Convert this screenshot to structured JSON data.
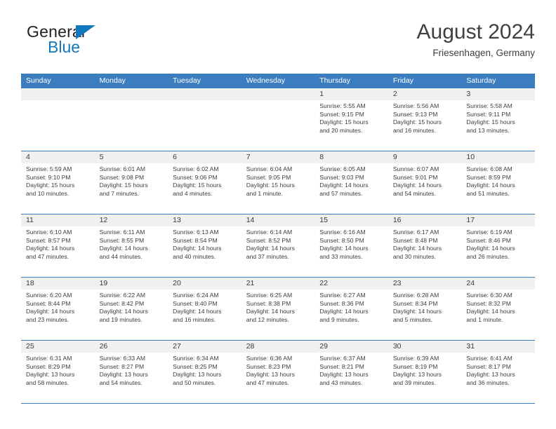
{
  "brand": {
    "name_part1": "General",
    "name_part2": "Blue",
    "triangle_color": "#1277bc",
    "text_color": "#231f20"
  },
  "header": {
    "title": "August 2024",
    "subtitle": "Friesenhagen, Germany"
  },
  "theme": {
    "header_band": "#3b7dbf",
    "date_strip": "#f0f0f0",
    "row_divider": "#3b7dbf",
    "text": "#3a3a3a"
  },
  "weekdays": [
    "Sunday",
    "Monday",
    "Tuesday",
    "Wednesday",
    "Thursday",
    "Friday",
    "Saturday"
  ],
  "weeks": [
    [
      {
        "day": "",
        "lines": []
      },
      {
        "day": "",
        "lines": []
      },
      {
        "day": "",
        "lines": []
      },
      {
        "day": "",
        "lines": []
      },
      {
        "day": "1",
        "lines": [
          "Sunrise: 5:55 AM",
          "Sunset: 9:15 PM",
          "Daylight: 15 hours",
          "and 20 minutes."
        ]
      },
      {
        "day": "2",
        "lines": [
          "Sunrise: 5:56 AM",
          "Sunset: 9:13 PM",
          "Daylight: 15 hours",
          "and 16 minutes."
        ]
      },
      {
        "day": "3",
        "lines": [
          "Sunrise: 5:58 AM",
          "Sunset: 9:11 PM",
          "Daylight: 15 hours",
          "and 13 minutes."
        ]
      }
    ],
    [
      {
        "day": "4",
        "lines": [
          "Sunrise: 5:59 AM",
          "Sunset: 9:10 PM",
          "Daylight: 15 hours",
          "and 10 minutes."
        ]
      },
      {
        "day": "5",
        "lines": [
          "Sunrise: 6:01 AM",
          "Sunset: 9:08 PM",
          "Daylight: 15 hours",
          "and 7 minutes."
        ]
      },
      {
        "day": "6",
        "lines": [
          "Sunrise: 6:02 AM",
          "Sunset: 9:06 PM",
          "Daylight: 15 hours",
          "and 4 minutes."
        ]
      },
      {
        "day": "7",
        "lines": [
          "Sunrise: 6:04 AM",
          "Sunset: 9:05 PM",
          "Daylight: 15 hours",
          "and 1 minute."
        ]
      },
      {
        "day": "8",
        "lines": [
          "Sunrise: 6:05 AM",
          "Sunset: 9:03 PM",
          "Daylight: 14 hours",
          "and 57 minutes."
        ]
      },
      {
        "day": "9",
        "lines": [
          "Sunrise: 6:07 AM",
          "Sunset: 9:01 PM",
          "Daylight: 14 hours",
          "and 54 minutes."
        ]
      },
      {
        "day": "10",
        "lines": [
          "Sunrise: 6:08 AM",
          "Sunset: 8:59 PM",
          "Daylight: 14 hours",
          "and 51 minutes."
        ]
      }
    ],
    [
      {
        "day": "11",
        "lines": [
          "Sunrise: 6:10 AM",
          "Sunset: 8:57 PM",
          "Daylight: 14 hours",
          "and 47 minutes."
        ]
      },
      {
        "day": "12",
        "lines": [
          "Sunrise: 6:11 AM",
          "Sunset: 8:55 PM",
          "Daylight: 14 hours",
          "and 44 minutes."
        ]
      },
      {
        "day": "13",
        "lines": [
          "Sunrise: 6:13 AM",
          "Sunset: 8:54 PM",
          "Daylight: 14 hours",
          "and 40 minutes."
        ]
      },
      {
        "day": "14",
        "lines": [
          "Sunrise: 6:14 AM",
          "Sunset: 8:52 PM",
          "Daylight: 14 hours",
          "and 37 minutes."
        ]
      },
      {
        "day": "15",
        "lines": [
          "Sunrise: 6:16 AM",
          "Sunset: 8:50 PM",
          "Daylight: 14 hours",
          "and 33 minutes."
        ]
      },
      {
        "day": "16",
        "lines": [
          "Sunrise: 6:17 AM",
          "Sunset: 8:48 PM",
          "Daylight: 14 hours",
          "and 30 minutes."
        ]
      },
      {
        "day": "17",
        "lines": [
          "Sunrise: 6:19 AM",
          "Sunset: 8:46 PM",
          "Daylight: 14 hours",
          "and 26 minutes."
        ]
      }
    ],
    [
      {
        "day": "18",
        "lines": [
          "Sunrise: 6:20 AM",
          "Sunset: 8:44 PM",
          "Daylight: 14 hours",
          "and 23 minutes."
        ]
      },
      {
        "day": "19",
        "lines": [
          "Sunrise: 6:22 AM",
          "Sunset: 8:42 PM",
          "Daylight: 14 hours",
          "and 19 minutes."
        ]
      },
      {
        "day": "20",
        "lines": [
          "Sunrise: 6:24 AM",
          "Sunset: 8:40 PM",
          "Daylight: 14 hours",
          "and 16 minutes."
        ]
      },
      {
        "day": "21",
        "lines": [
          "Sunrise: 6:25 AM",
          "Sunset: 8:38 PM",
          "Daylight: 14 hours",
          "and 12 minutes."
        ]
      },
      {
        "day": "22",
        "lines": [
          "Sunrise: 6:27 AM",
          "Sunset: 8:36 PM",
          "Daylight: 14 hours",
          "and 9 minutes."
        ]
      },
      {
        "day": "23",
        "lines": [
          "Sunrise: 6:28 AM",
          "Sunset: 8:34 PM",
          "Daylight: 14 hours",
          "and 5 minutes."
        ]
      },
      {
        "day": "24",
        "lines": [
          "Sunrise: 6:30 AM",
          "Sunset: 8:32 PM",
          "Daylight: 14 hours",
          "and 1 minute."
        ]
      }
    ],
    [
      {
        "day": "25",
        "lines": [
          "Sunrise: 6:31 AM",
          "Sunset: 8:29 PM",
          "Daylight: 13 hours",
          "and 58 minutes."
        ]
      },
      {
        "day": "26",
        "lines": [
          "Sunrise: 6:33 AM",
          "Sunset: 8:27 PM",
          "Daylight: 13 hours",
          "and 54 minutes."
        ]
      },
      {
        "day": "27",
        "lines": [
          "Sunrise: 6:34 AM",
          "Sunset: 8:25 PM",
          "Daylight: 13 hours",
          "and 50 minutes."
        ]
      },
      {
        "day": "28",
        "lines": [
          "Sunrise: 6:36 AM",
          "Sunset: 8:23 PM",
          "Daylight: 13 hours",
          "and 47 minutes."
        ]
      },
      {
        "day": "29",
        "lines": [
          "Sunrise: 6:37 AM",
          "Sunset: 8:21 PM",
          "Daylight: 13 hours",
          "and 43 minutes."
        ]
      },
      {
        "day": "30",
        "lines": [
          "Sunrise: 6:39 AM",
          "Sunset: 8:19 PM",
          "Daylight: 13 hours",
          "and 39 minutes."
        ]
      },
      {
        "day": "31",
        "lines": [
          "Sunrise: 6:41 AM",
          "Sunset: 8:17 PM",
          "Daylight: 13 hours",
          "and 36 minutes."
        ]
      }
    ]
  ]
}
